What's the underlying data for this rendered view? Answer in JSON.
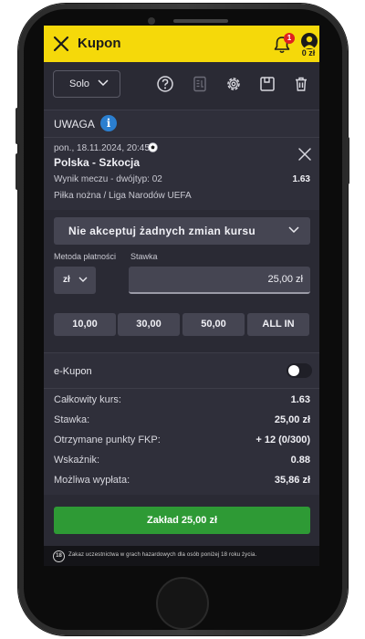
{
  "header": {
    "title": "Kupon",
    "notification_count": "1",
    "balance": "0 zł",
    "accent_color": "#f5d90a"
  },
  "toolbar": {
    "mode_label": "Solo",
    "icons": [
      "help-icon",
      "receipt-icon",
      "settings-icon",
      "save-icon",
      "trash-icon"
    ]
  },
  "warning": {
    "label": "UWAGA",
    "info_glyph": "i"
  },
  "bet": {
    "datetime": "pon., 18.11.2024, 20:45",
    "teams": "Polska - Szkocja",
    "market": "Wynik meczu - dwójtyp: 02",
    "odds": "1.63",
    "league": "Piłka nożna / Liga Narodów UEFA"
  },
  "slip": {
    "odds_change_option": "Nie akceptuj żadnych zmian kursu",
    "payment_method_label": "Metoda płatności",
    "stake_label": "Stawka",
    "currency": "zł",
    "stake_value": "25,00 zł",
    "quick_amounts": [
      "10,00",
      "30,00",
      "50,00",
      "ALL IN"
    ]
  },
  "summary": {
    "ekupon_label": "e-Kupon",
    "ekupon_enabled": false,
    "rows": [
      {
        "label": "Całkowity kurs:",
        "value": "1.63"
      },
      {
        "label": "Stawka:",
        "value": "25,00 zł"
      },
      {
        "label": "Otrzymane punkty FKP:",
        "value": "+ 12 (0/300)"
      },
      {
        "label": "Wskaźnik:",
        "value": "0.88"
      },
      {
        "label": "Możliwa wypłata:",
        "value": "35,86 zł"
      }
    ]
  },
  "footer": {
    "place_bet_label": "Zakład 25,00 zł",
    "place_bet_color": "#2e9a35",
    "age_badge": "18",
    "disclaimer": "Zakaz uczestnictwa w grach hazardowych dla osób poniżej 18 roku życia."
  }
}
